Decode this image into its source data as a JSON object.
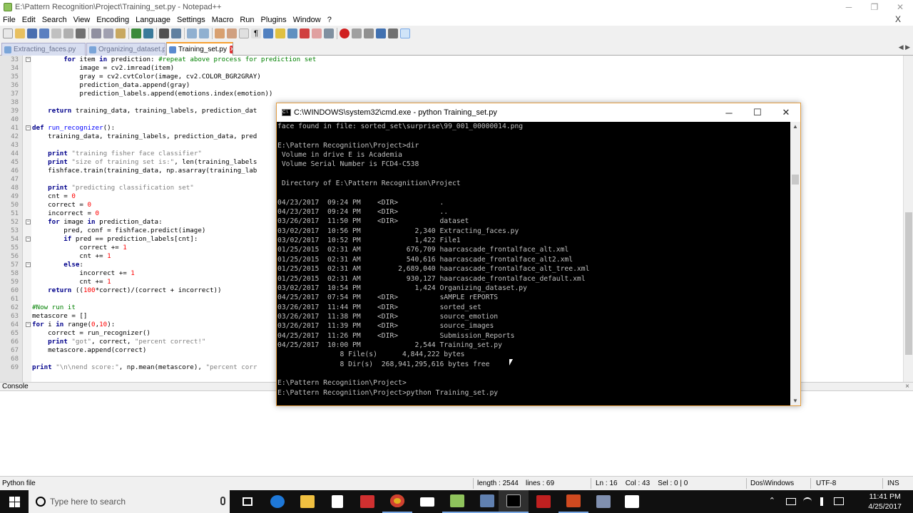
{
  "window": {
    "title": "E:\\Pattern Recognition\\Project\\Training_set.py - Notepad++",
    "minimize": "─",
    "maximize": "❐",
    "close": "✕"
  },
  "menu": {
    "items": [
      "File",
      "Edit",
      "Search",
      "View",
      "Encoding",
      "Language",
      "Settings",
      "Macro",
      "Run",
      "Plugins",
      "Window",
      "?"
    ],
    "close": "X"
  },
  "tabs": [
    {
      "label": "Extracting_faces.py",
      "active": false
    },
    {
      "label": "Organizing_dataset.py",
      "active": false
    },
    {
      "label": "Training_set.py",
      "active": true
    }
  ],
  "editor": {
    "line_numbers": [
      "33",
      "34",
      "35",
      "36",
      "37",
      "38",
      "39",
      "40",
      "41",
      "42",
      "43",
      "44",
      "45",
      "46",
      "47",
      "48",
      "49",
      "50",
      "51",
      "52",
      "53",
      "54",
      "55",
      "56",
      "57",
      "58",
      "59",
      "60",
      "61",
      "62",
      "63",
      "64",
      "65",
      "66",
      "67",
      "68",
      "69"
    ],
    "lines": [
      "        for item in prediction: #repeat above process for prediction set",
      "            image = cv2.imread(item)",
      "            gray = cv2.cvtColor(image, cv2.COLOR_BGR2GRAY)",
      "            prediction_data.append(gray)",
      "            prediction_labels.append(emotions.index(emotion))",
      "",
      "    return training_data, training_labels, prediction_dat",
      "",
      "def run_recognizer():",
      "    training_data, training_labels, prediction_data, pred",
      "",
      "    print \"training fisher face classifier\"",
      "    print \"size of training set is:\", len(training_labels",
      "    fishface.train(training_data, np.asarray(training_lab",
      "",
      "    print \"predicting classification set\"",
      "    cnt = 0",
      "    correct = 0",
      "    incorrect = 0",
      "    for image in prediction_data:",
      "        pred, conf = fishface.predict(image)",
      "        if pred == prediction_labels[cnt]:",
      "            correct += 1",
      "            cnt += 1",
      "        else:",
      "            incorrect += 1",
      "            cnt += 1",
      "    return ((100*correct)/(correct + incorrect))",
      "",
      "#Now run it",
      "metascore = []",
      "for i in range(0,10):",
      "    correct = run_recognizer()",
      "    print \"got\", correct, \"percent correct!\"",
      "    metascore.append(correct)",
      "",
      "print \"\\n\\nend score:\", np.mean(metascore), \"percent corr"
    ]
  },
  "console": {
    "label": "Console",
    "close": "×"
  },
  "statusbar": {
    "file_type": "Python file",
    "length": "length : 2544",
    "lines": "lines : 69",
    "position": "Ln : 16    Col : 43    Sel : 0 | 0",
    "eol": "Dos\\Windows",
    "encoding": "UTF-8",
    "mode": "INS"
  },
  "cmd": {
    "title": "C:\\WINDOWS\\system32\\cmd.exe - python  Training_set.py",
    "icon_text": "C:\\",
    "minimize": "─",
    "maximize": "☐",
    "close": "✕",
    "output": "face found in file: sorted_set\\surprise\\99_001_00000014.png\n\nE:\\Pattern Recognition\\Project>dir\n Volume in drive E is Academia\n Volume Serial Number is FCD4-C538\n\n Directory of E:\\Pattern Recognition\\Project\n\n04/23/2017  09:24 PM    <DIR>          .\n04/23/2017  09:24 PM    <DIR>          ..\n03/26/2017  11:50 PM    <DIR>          dataset\n03/02/2017  10:56 PM             2,340 Extracting_faces.py\n03/02/2017  10:52 PM             1,422 File1\n01/25/2015  02:31 AM           676,709 haarcascade_frontalface_alt.xml\n01/25/2015  02:31 AM           540,616 haarcascade_frontalface_alt2.xml\n01/25/2015  02:31 AM         2,689,040 haarcascade_frontalface_alt_tree.xml\n01/25/2015  02:31 AM           930,127 haarcascade_frontalface_default.xml\n03/02/2017  10:54 PM             1,424 Organizing_dataset.py\n04/25/2017  07:54 PM    <DIR>          sAMPLE rEPORTS\n03/26/2017  11:44 PM    <DIR>          sorted_set\n03/26/2017  11:38 PM    <DIR>          source_emotion\n03/26/2017  11:39 PM    <DIR>          source_images\n04/25/2017  11:26 PM    <DIR>          Submission_Reports\n04/25/2017  10:00 PM             2,544 Training_set.py\n               8 File(s)      4,844,222 bytes\n               8 Dir(s)  268,941,295,616 bytes free\n\nE:\\Pattern Recognition\\Project>\nE:\\Pattern Recognition\\Project>python Training_set.py\n_"
  },
  "taskbar": {
    "search_placeholder": "Type here to search",
    "time": "11:41 PM",
    "date": "4/25/2017",
    "tray_up": "⌃"
  }
}
